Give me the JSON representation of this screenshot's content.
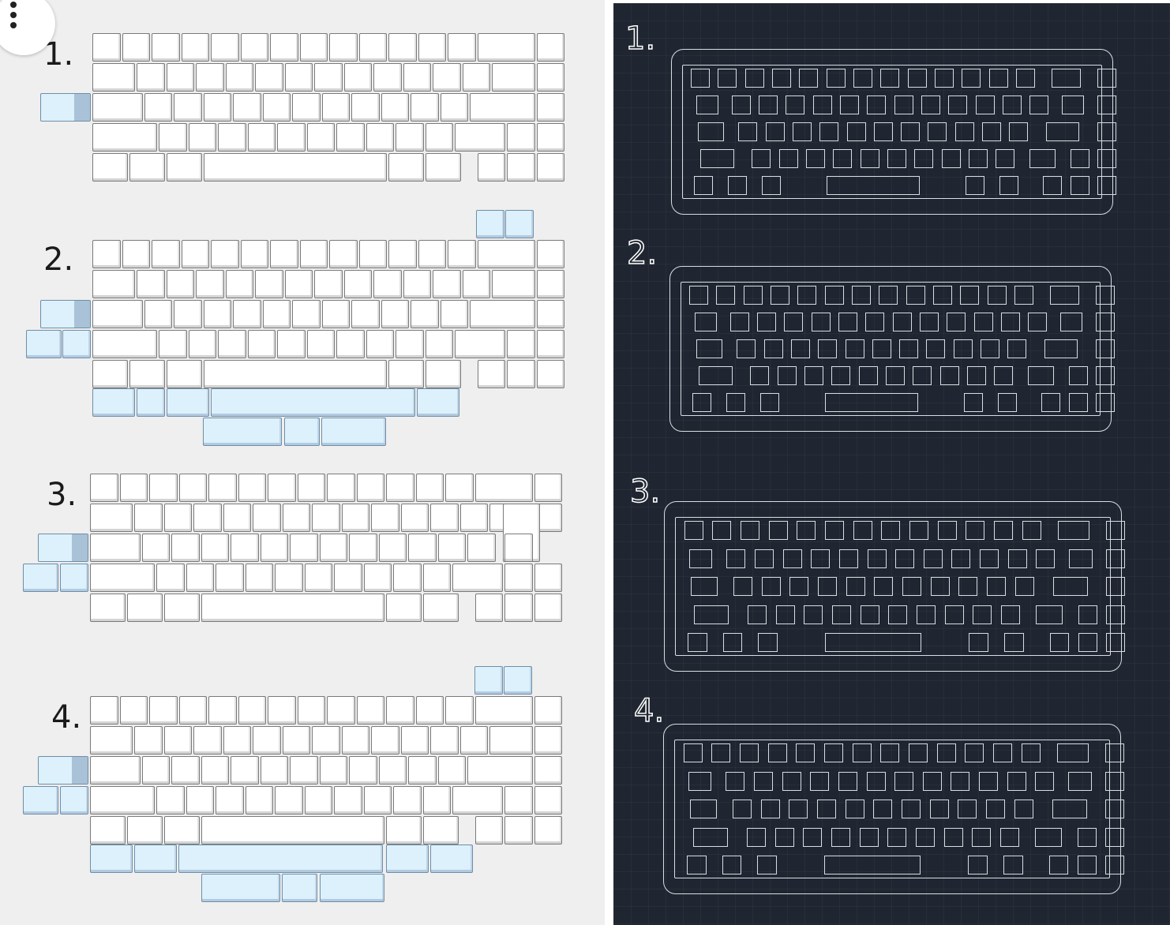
{
  "colors": {
    "left_background": "#efefef",
    "right_background": "#1f2631",
    "key_white": "#ffffff",
    "key_blue": "#dcf1fb",
    "outline": "#d9dde3"
  },
  "menu": {
    "icon": "more-vertical-icon"
  },
  "layouts": [
    {
      "number": "1."
    },
    {
      "number": "2."
    },
    {
      "number": "3."
    },
    {
      "number": "4."
    }
  ],
  "plates": [
    {
      "number": "1."
    },
    {
      "number": "2."
    },
    {
      "number": "3."
    },
    {
      "number": "4."
    }
  ]
}
